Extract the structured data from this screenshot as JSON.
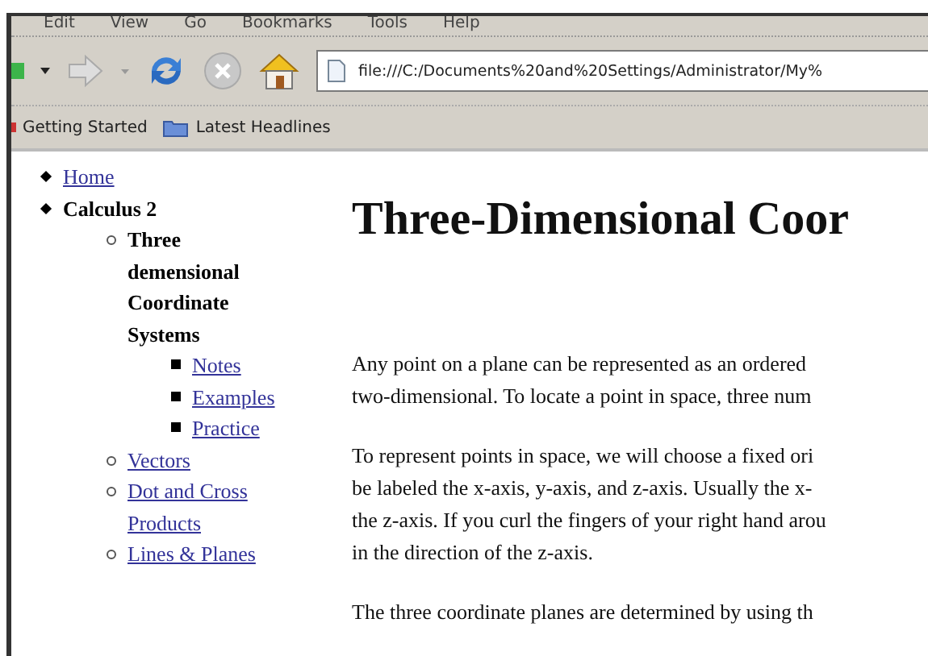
{
  "menu": [
    "Edit",
    "View",
    "Go",
    "Bookmarks",
    "Tools",
    "Help"
  ],
  "toolbar": {
    "address": "file:///C:/Documents%20and%20Settings/Administrator/My%"
  },
  "bookmarks": [
    {
      "label": "Getting Started",
      "kind": "page"
    },
    {
      "label": "Latest Headlines",
      "kind": "feed"
    }
  ],
  "nav": [
    {
      "label": "Home",
      "kind": "link"
    },
    {
      "label": "Calculus 2",
      "kind": "current",
      "children": [
        {
          "label": "Three demensional Coordinate Systems",
          "kind": "current",
          "children": [
            {
              "label": "Notes",
              "kind": "link"
            },
            {
              "label": "Examples",
              "kind": "link"
            },
            {
              "label": "Practice",
              "kind": "link"
            }
          ]
        },
        {
          "label": "Vectors",
          "kind": "link"
        },
        {
          "label": "Dot and Cross Products",
          "kind": "link"
        },
        {
          "label": "Lines & Planes",
          "kind": "link"
        }
      ]
    }
  ],
  "article": {
    "heading": "Three-Dimensional Coor",
    "paragraphs": [
      [
        "Any point on a plane can be represented as an ordered",
        "two-dimensional. To locate a point in space, three num"
      ],
      [
        "To represent points in space, we will choose a fixed ori",
        "be labeled the x-axis, y-axis, and z-axis. Usually the x-",
        "the z-axis. If you curl the fingers of your right hand arou",
        "in the direction of the z-axis."
      ],
      [
        "The three coordinate planes are determined by using th"
      ]
    ]
  }
}
